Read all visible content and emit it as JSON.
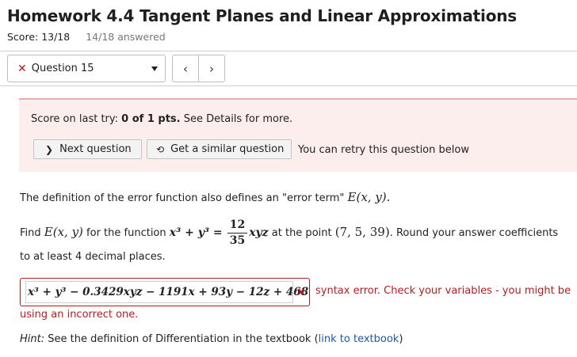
{
  "header": {
    "title": "Homework 4.4 Tangent Planes and Linear Approximations",
    "score": "Score: 13/18",
    "answered": "14/18 answered"
  },
  "question_nav": {
    "selected_question": "Question 15",
    "prev_symbol": "‹",
    "next_symbol": "›"
  },
  "alert": {
    "prefix": "Score on last try: ",
    "score_bold": "0 of 1 pts.",
    "suffix": " See Details for more.",
    "next_button": "Next question",
    "similar_button": "Get a similar question",
    "retry_text": "You can retry this question below"
  },
  "question": {
    "line1_text": "The definition of the error function also defines an \"error term\" ",
    "line1_math": "E(x, y).",
    "line2_find": "Find ",
    "line2_E": "E(x, y)",
    "line2_for": " for the function ",
    "line2_lhs": "x³ + y³ =",
    "frac_num": "12",
    "frac_den": "35",
    "line2_xyz": "xyz",
    "line2_at": " at the point ",
    "line2_point": "(7, 5, 39)",
    "line2_round": ". Round your answer coefficients",
    "line3": "to at least 4 decimal places."
  },
  "answer": {
    "value": "x³ + y³ − 0.3429xyz − 1191x + 93y − 12z + 468",
    "status_icon": "×"
  },
  "error": {
    "line1": "syntax error. Check your variables - you might be",
    "line2": "using an incorrect one."
  },
  "hint": {
    "label": "Hint:",
    "text": " See the definition of Differentiation in the textbook (",
    "link": "link to textbook",
    "close": ")"
  }
}
